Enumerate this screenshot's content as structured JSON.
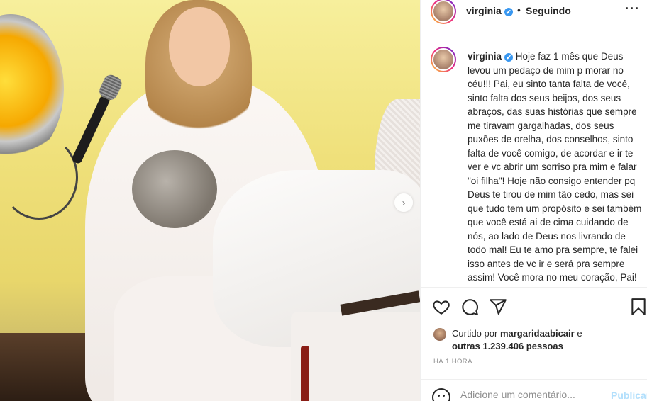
{
  "post": {
    "username": "virginia",
    "verified_mark": "✔",
    "follow_dot": "•",
    "follow_status": "Seguindo",
    "more_icon": "···",
    "next_icon": "›",
    "caption_text": "Hoje faz 1 mês que Deus levou um pedaço de mim p morar no céu!!! Pai, eu sinto tanta falta de você, sinto falta dos seus beijos, dos seus abraços, das suas histórias que sempre me tiravam gargalhadas, dos seus puxões de orelha, dos conselhos, sinto falta de você comigo, de acordar e ir te ver e vc abrir um sorriso pra mim e falar \"oi filha\"! Hoje não consigo entender pq Deus te tirou de mim tão cedo, mas sei que tudo tem um propósito e sei também que você está ai de cima cuidando de nós, ao lado de Deus nos livrando de todo mal! Eu te amo pra sempre, te falei isso antes de vc ir e será pra sempre assim! Você mora no meu coração, Pai! Irei te carregar p sempre comigo",
    "caption_emoji": "❤️",
    "icons": [
      "heart-icon",
      "comment-icon",
      "share-icon",
      "bookmark-icon"
    ],
    "likes": {
      "prefix": "Curtido por",
      "user": "margaridaabicair",
      "conj": "e",
      "others": "outras 1.239.406 pessoas"
    },
    "time_ago": "HÁ 1 HORA",
    "comment": {
      "placeholder": "Adicione um comentário...",
      "publish_label": "Publicar"
    }
  }
}
